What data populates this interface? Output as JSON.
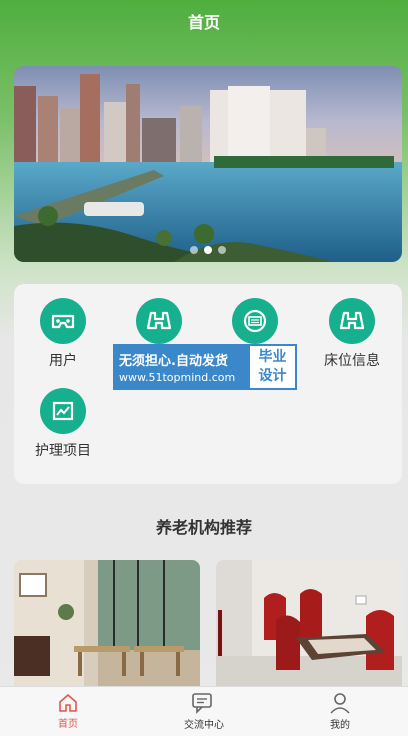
{
  "header": {
    "title": "首页"
  },
  "banner": {
    "dots": 3,
    "active_index": 1
  },
  "menu": {
    "items": [
      {
        "label": "用户",
        "icon": "vr-goggles-icon"
      },
      {
        "label": "",
        "icon": "binoculars-icon"
      },
      {
        "label": "",
        "icon": "keyboard-icon"
      },
      {
        "label": "床位信息",
        "icon": "binoculars-icon"
      },
      {
        "label": "护理项目",
        "icon": "chart-icon"
      }
    ]
  },
  "watermark": {
    "line1": "无须担心.自动发货",
    "line2": "www.51topmind.com",
    "right1": "毕业",
    "right2": "设计"
  },
  "recommend": {
    "title": "养老机构推荐"
  },
  "tabbar": {
    "items": [
      {
        "label": "首页",
        "icon": "home-icon",
        "active": true
      },
      {
        "label": "交流中心",
        "icon": "chat-icon",
        "active": false
      },
      {
        "label": "我的",
        "icon": "user-icon",
        "active": false
      }
    ]
  },
  "colors": {
    "brand_green": "#4fae3e",
    "icon_teal": "#17b08e",
    "active_tab": "#e2574c",
    "watermark_blue": "#3a87c9"
  }
}
